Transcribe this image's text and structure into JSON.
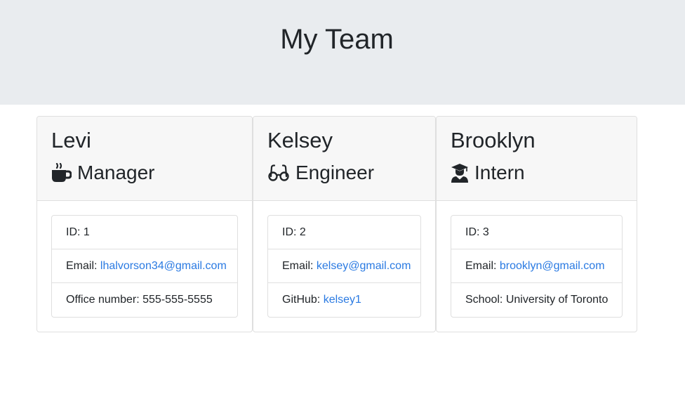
{
  "header": {
    "title": "My Team"
  },
  "cards": [
    {
      "name": "Levi",
      "role": "Manager",
      "role_icon": "coffee-mug-icon",
      "id_label": "ID: ",
      "id": "1",
      "email_label": "Email: ",
      "email": "lhalvorson34@gmail.com",
      "extra_label": "Office number: ",
      "extra_value": "555-555-5555"
    },
    {
      "name": "Kelsey",
      "role": "Engineer",
      "role_icon": "glasses-icon",
      "id_label": "ID: ",
      "id": "2",
      "email_label": "Email: ",
      "email": "kelsey@gmail.com",
      "extra_label": "GitHub: ",
      "extra_value": "kelsey1"
    },
    {
      "name": "Brooklyn",
      "role": "Intern",
      "role_icon": "graduate-icon",
      "id_label": "ID: ",
      "id": "3",
      "email_label": "Email: ",
      "email": "brooklyn@gmail.com",
      "extra_label": "School: ",
      "extra_value": "University of Toronto"
    }
  ],
  "colors": {
    "jumbotron_bg": "#e9ecef",
    "card_header_bg": "#f7f7f7",
    "link": "#2a7ae2",
    "text": "#212529"
  }
}
